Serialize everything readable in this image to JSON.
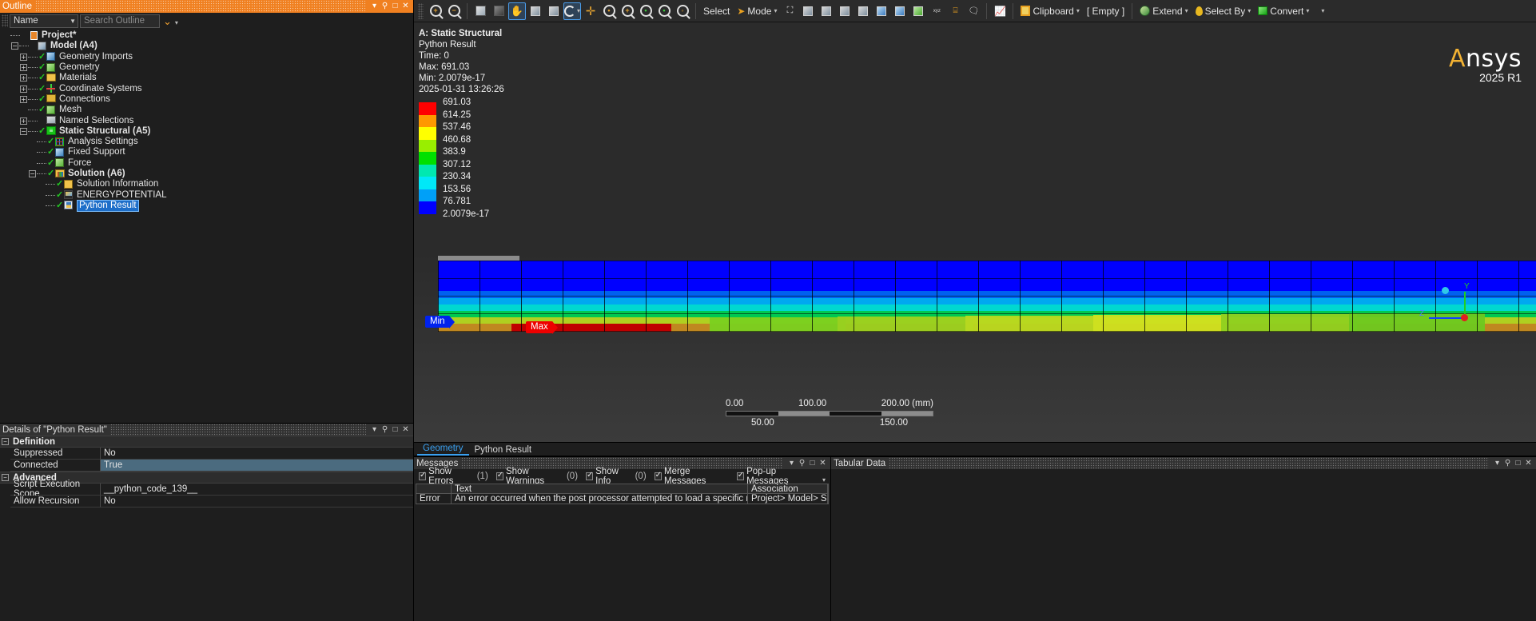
{
  "outline": {
    "title": "Outline",
    "titlebar_buttons": [
      "▾",
      "⚲",
      "□",
      "✕"
    ],
    "filter_combo": "Name",
    "search_placeholder": "Search Outline",
    "tree": [
      {
        "label": "Project*",
        "depth": 0,
        "bold": true,
        "icon": "project-icon",
        "expander": "",
        "check": false
      },
      {
        "label": "Model (A4)",
        "depth": 1,
        "bold": true,
        "icon": "model-icon",
        "expander": "−",
        "check": false
      },
      {
        "label": "Geometry Imports",
        "depth": 2,
        "bold": false,
        "icon": "geometry-imports-icon",
        "expander": "+",
        "check": true
      },
      {
        "label": "Geometry",
        "depth": 2,
        "bold": false,
        "icon": "geometry-icon",
        "expander": "+",
        "check": true
      },
      {
        "label": "Materials",
        "depth": 2,
        "bold": false,
        "icon": "materials-icon",
        "expander": "+",
        "check": true
      },
      {
        "label": "Coordinate Systems",
        "depth": 2,
        "bold": false,
        "icon": "coordinate-systems-icon",
        "expander": "+",
        "check": true
      },
      {
        "label": "Connections",
        "depth": 2,
        "bold": false,
        "icon": "connections-icon",
        "expander": "+",
        "check": true
      },
      {
        "label": "Mesh",
        "depth": 2,
        "bold": false,
        "icon": "mesh-icon",
        "expander": "",
        "check": true
      },
      {
        "label": "Named Selections",
        "depth": 2,
        "bold": false,
        "icon": "named-selections-icon",
        "expander": "+",
        "check": false
      },
      {
        "label": "Static Structural (A5)",
        "depth": 2,
        "bold": true,
        "icon": "static-structural-icon",
        "expander": "−",
        "check": true
      },
      {
        "label": "Analysis Settings",
        "depth": 3,
        "bold": false,
        "icon": "analysis-settings-icon",
        "expander": "",
        "check": true
      },
      {
        "label": "Fixed Support",
        "depth": 3,
        "bold": false,
        "icon": "fixed-support-icon",
        "expander": "",
        "check": true
      },
      {
        "label": "Force",
        "depth": 3,
        "bold": false,
        "icon": "force-icon",
        "expander": "",
        "check": true
      },
      {
        "label": "Solution (A6)",
        "depth": 3,
        "bold": true,
        "icon": "solution-icon",
        "expander": "−",
        "check": true
      },
      {
        "label": "Solution Information",
        "depth": 4,
        "bold": false,
        "icon": "solution-information-icon",
        "expander": "",
        "check": true
      },
      {
        "label": "ENERGYPOTENTIAL",
        "depth": 4,
        "bold": false,
        "icon": "energy-potential-icon",
        "expander": "",
        "check": true
      },
      {
        "label": "Python Result",
        "depth": 4,
        "bold": false,
        "icon": "python-result-icon",
        "expander": "",
        "check": true,
        "selected": true
      }
    ]
  },
  "details": {
    "title": "Details of \"Python Result\"",
    "titlebar_buttons": [
      "▾",
      "⚲",
      "□",
      "✕"
    ],
    "groups": [
      {
        "name": "Definition",
        "rows": [
          {
            "key": "Suppressed",
            "value": "No",
            "highlight": false
          },
          {
            "key": "Connected",
            "value": "True",
            "highlight": true
          }
        ]
      },
      {
        "name": "Advanced",
        "rows": [
          {
            "key": "Script Execution Scope",
            "value": "__python_code_139__",
            "highlight": false
          },
          {
            "key": "Allow Recursion",
            "value": "No",
            "highlight": false
          }
        ]
      }
    ]
  },
  "toolbar": {
    "select_label": "Select",
    "mode_label": "Mode",
    "clipboard_label": "Clipboard",
    "empty_label": "[ Empty ]",
    "extend_label": "Extend",
    "select_by_label": "Select By",
    "convert_label": "Convert",
    "icons": [
      "zoom-in-icon",
      "zoom-out-icon",
      "box-select-icon",
      "solid-cube-icon",
      "rotate-hand-icon",
      "box-zoom-icon",
      "box-fit-icon",
      "rotate-icon",
      "pan-icon",
      "zoom-to-fit-icon",
      "magnify-plus-icon",
      "magnify-green-icon",
      "magnify-target-icon",
      "magnify-fit-icon"
    ]
  },
  "viewport": {
    "header": {
      "analysis": "A: Static Structural",
      "result_name": "Python Result",
      "time": "Time: 0",
      "max": "Max: 691.03",
      "min": "Min: 2.0079e-17",
      "timestamp": "2025-01-31 13:26:26"
    },
    "legend": {
      "values": [
        "691.03",
        "614.25",
        "537.46",
        "460.68",
        "383.9",
        "307.12",
        "230.34",
        "153.56",
        "76.781",
        "2.0079e-17"
      ],
      "colors": [
        "#ff0000",
        "#ff9900",
        "#ffff00",
        "#99ee00",
        "#00e000",
        "#00e8b0",
        "#00e8f8",
        "#00a0f8",
        "#0000ff"
      ]
    },
    "tags": {
      "min": "Min",
      "max": "Max"
    },
    "scalebar": {
      "top_labels": [
        "0.00",
        "100.00",
        "200.00 (mm)"
      ],
      "bottom_labels": [
        "50.00",
        "150.00"
      ]
    },
    "triad_labels": {
      "x": "X",
      "y": "Y",
      "z": "Z"
    },
    "logo": {
      "name_a": "A",
      "name_rest": "nsys",
      "version": "2025 R1"
    }
  },
  "viewport_tabs": [
    {
      "label": "Geometry",
      "active": true
    },
    {
      "label": "Python Result",
      "active": false
    }
  ],
  "messages": {
    "title": "Messages",
    "titlebar_buttons": [
      "▾",
      "⚲",
      "□",
      "✕"
    ],
    "options": [
      {
        "label": "Show Errors",
        "count": "(1)",
        "checked": true
      },
      {
        "label": "Show Warnings",
        "count": "(0)",
        "checked": true
      },
      {
        "label": "Show Info",
        "count": "(0)",
        "checked": true
      },
      {
        "label": "Merge Messages",
        "count": "",
        "checked": true
      },
      {
        "label": "Pop-up Messages",
        "count": "",
        "checked": true
      }
    ],
    "columns": [
      "",
      "Text",
      "Association"
    ],
    "rows": [
      {
        "type": "Error",
        "text": "An error occurred when the post processor attempted to load a specific result. Please revi",
        "association": "Project> Model> Static S"
      }
    ]
  },
  "tabular_data": {
    "title": "Tabular Data",
    "titlebar_buttons": [
      "▾",
      "⚲",
      "□",
      "✕"
    ]
  },
  "colors": {
    "accent_orange": "#f08020",
    "selection_blue": "#1d6ec9",
    "tab_active": "#3aa0f0"
  }
}
